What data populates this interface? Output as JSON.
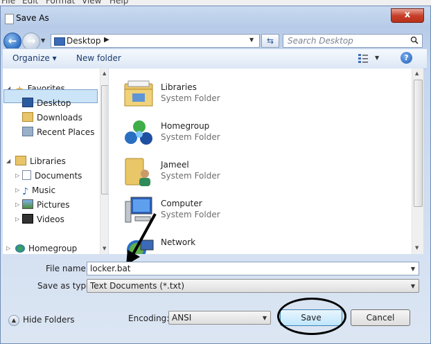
{
  "menubar": {
    "items": [
      "File",
      "Edit",
      "Format",
      "View",
      "Help"
    ]
  },
  "window": {
    "title": "Save As",
    "close_glyph": "x"
  },
  "nav": {
    "address_location": "Desktop",
    "address_chevron": "▶",
    "search_placeholder": "Search Desktop"
  },
  "toolbar": {
    "organize": "Organize ▾",
    "new_folder": "New folder",
    "help_glyph": "?"
  },
  "sidebar": {
    "favorites": "Favorites",
    "favorites_items": [
      "Desktop",
      "Downloads",
      "Recent Places"
    ],
    "libraries": "Libraries",
    "libraries_items": [
      "Documents",
      "Music",
      "Pictures",
      "Videos"
    ],
    "homegroup": "Homegroup"
  },
  "content": {
    "items": [
      {
        "name": "Libraries",
        "type": "System Folder",
        "icon": "libraries-folder-icon"
      },
      {
        "name": "Homegroup",
        "type": "System Folder",
        "icon": "homegroup-icon"
      },
      {
        "name": "Jameel",
        "type": "System Folder",
        "icon": "user-folder-icon"
      },
      {
        "name": "Computer",
        "type": "System Folder",
        "icon": "computer-icon"
      },
      {
        "name": "Network",
        "type": "",
        "icon": "network-icon"
      }
    ]
  },
  "form": {
    "file_name_label": "File name:",
    "file_name_value": "locker.bat",
    "save_type_label": "Save as type:",
    "save_type_value": "Text Documents (*.txt)",
    "encoding_label": "Encoding:",
    "encoding_value": "ANSI",
    "hide_folders": "Hide Folders",
    "save_button": "Save",
    "cancel_button": "Cancel"
  },
  "colors": {
    "selection": "#cce4f7",
    "accent": "#3a6ab8",
    "close": "#c7402a"
  }
}
